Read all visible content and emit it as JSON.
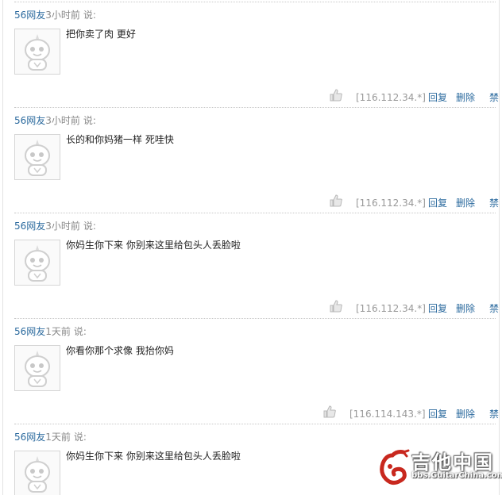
{
  "comments": [
    {
      "user": "56网友",
      "time": "3小时前",
      "said": "说:",
      "text": "把你卖了肉 更好",
      "ip": "[116.112.34.*]"
    },
    {
      "user": "56网友",
      "time": "3小时前",
      "said": "说:",
      "text": "长的和你妈猪一样 死哇快",
      "ip": "[116.112.34.*]"
    },
    {
      "user": "56网友",
      "time": "3小时前",
      "said": "说:",
      "text": "你妈生你下来 你别来这里给包头人丢脸啦",
      "ip": "[116.112.34.*]"
    },
    {
      "user": "56网友",
      "time": "1天前",
      "said": "说:",
      "text": "你看你那个求像 我抬你妈",
      "ip": "[116.114.143.*]"
    },
    {
      "user": "56网友",
      "time": "1天前",
      "said": "说:",
      "text": "你妈生你下来 你别来这里给包头人丢脸啦",
      "ip": ""
    }
  ],
  "actions": {
    "reply": "回复",
    "delete": "删除",
    "ban": "禁"
  },
  "watermark": {
    "cn": "吉他中国",
    "en": "bbs.GuitarChina.com"
  },
  "colors": {
    "link": "#2b6a9e",
    "muted": "#888888",
    "ip": "#999999"
  },
  "icons": {
    "avatar": "default-avatar-icon",
    "like": "thumbs-up-icon",
    "logo": "guitarchina-logo-icon"
  }
}
